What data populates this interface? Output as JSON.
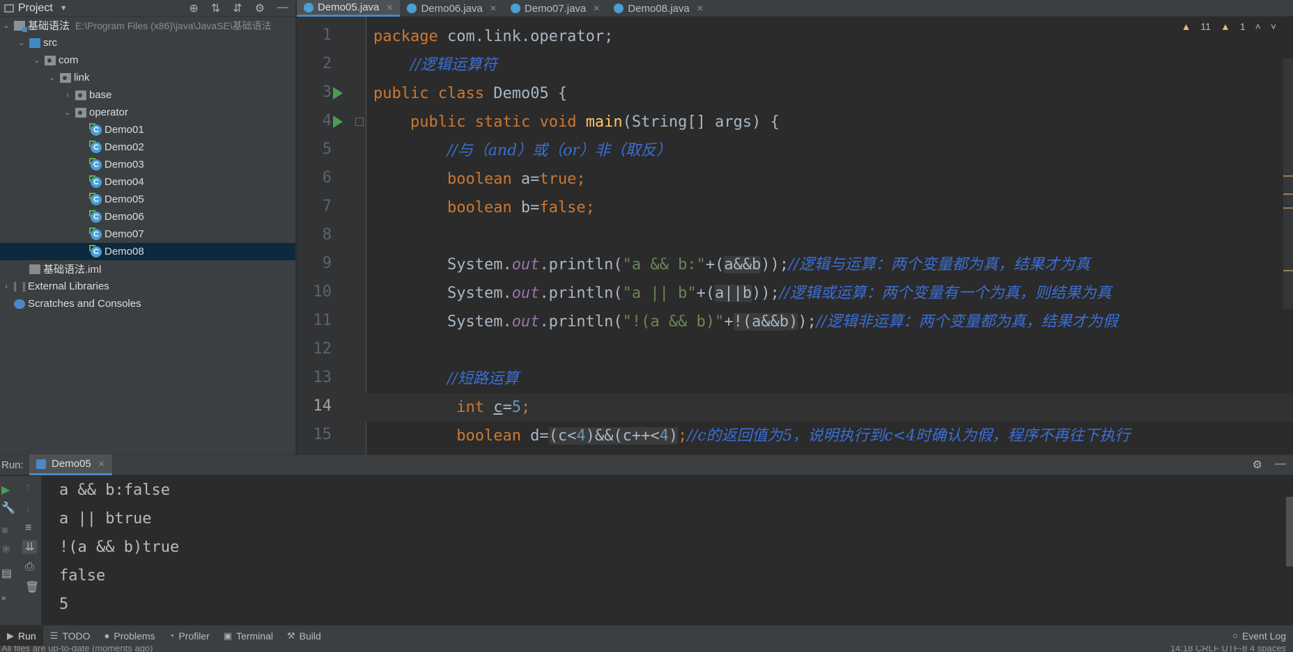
{
  "project_panel": {
    "title": "Project",
    "tree": [
      {
        "label": "基础语法",
        "path": "E:\\Program Files (x86)\\java\\JavaSE\\基础语法",
        "type": "module",
        "depth": 0,
        "arrow": "v"
      },
      {
        "label": "src",
        "type": "src-folder",
        "depth": 1,
        "arrow": "v"
      },
      {
        "label": "com",
        "type": "package",
        "depth": 2,
        "arrow": "v"
      },
      {
        "label": "link",
        "type": "package",
        "depth": 3,
        "arrow": "v"
      },
      {
        "label": "base",
        "type": "package",
        "depth": 4,
        "arrow": ">"
      },
      {
        "label": "operator",
        "type": "package",
        "depth": 4,
        "arrow": "v"
      },
      {
        "label": "Demo01",
        "type": "class",
        "depth": 5
      },
      {
        "label": "Demo02",
        "type": "class",
        "depth": 5
      },
      {
        "label": "Demo03",
        "type": "class",
        "depth": 5
      },
      {
        "label": "Demo04",
        "type": "class",
        "depth": 5
      },
      {
        "label": "Demo05",
        "type": "class",
        "depth": 5
      },
      {
        "label": "Demo06",
        "type": "class",
        "depth": 5
      },
      {
        "label": "Demo07",
        "type": "class",
        "depth": 5
      },
      {
        "label": "Demo08",
        "type": "class",
        "depth": 5,
        "selected": true
      },
      {
        "label": "基础语法.iml",
        "type": "iml",
        "depth": 1
      },
      {
        "label": "External Libraries",
        "type": "libs",
        "depth": 0,
        "arrow": ">"
      },
      {
        "label": "Scratches and Consoles",
        "type": "scratches",
        "depth": 0
      }
    ]
  },
  "editor": {
    "tabs": [
      {
        "label": "Demo05.java",
        "active": true
      },
      {
        "label": "Demo06.java"
      },
      {
        "label": "Demo07.java"
      },
      {
        "label": "Demo08.java"
      }
    ],
    "inspections": {
      "warnings": "11",
      "weak_warnings": "1"
    },
    "line_numbers": [
      "1",
      "2",
      "3",
      "4",
      "5",
      "6",
      "7",
      "8",
      "9",
      "10",
      "11",
      "12",
      "13",
      "14",
      "15"
    ],
    "code": {
      "l1_kw": "package",
      "l1_rest": " com.link.operator;",
      "l2_cmt": "//逻辑运算符",
      "l3_kw1": "public",
      "l3_kw2": "class",
      "l3_rest": " Demo05 {",
      "l4_kw1": "public",
      "l4_kw2": "static",
      "l4_kw3": "void",
      "l4_fn": "main",
      "l4_rest": "(String[] args) {",
      "l5_cmt": "//与（and）或（or）非（取反）",
      "l6_kw": "boolean",
      "l6_mid": " a=",
      "l6_val": "true",
      "l6_end": ";",
      "l7_kw": "boolean",
      "l7_mid": " b=",
      "l7_val": "false",
      "l7_end": ";",
      "l9_a": "System.",
      "l9_field": "out",
      "l9_b": ".println(",
      "l9_str": "\"a && b:\"",
      "l9_c": "+(",
      "l9_hl": "a&&b",
      "l9_d": "));",
      "l9_cmt": "//逻辑与运算：两个变量都为真，结果才为真",
      "l10_a": "System.",
      "l10_field": "out",
      "l10_b": ".println(",
      "l10_str": "\"a || b\"",
      "l10_c": "+(",
      "l10_hl": "a||b",
      "l10_d": "));",
      "l10_cmt": "//逻辑或运算：两个变量有一个为真，则结果为真",
      "l11_a": "System.",
      "l11_field": "out",
      "l11_b": ".println(",
      "l11_str": "\"!(a && b)\"",
      "l11_c": "+",
      "l11_hl": "!(a&&b)",
      "l11_d": ");",
      "l11_cmt": "//逻辑非运算：两个变量都为真，结果才为假",
      "l13_cmt": "//短路运算",
      "l14_kw": "int",
      "l14_var": "c",
      "l14_mid": "=",
      "l14_num": "5",
      "l14_end": ";",
      "l15_kw": "boolean",
      "l15_a": " d=",
      "l15_hl1": "(c<",
      "l15_n1": "4",
      "l15_hl2": ")&&(c++<",
      "l15_n2": "4",
      "l15_hl3": ")",
      "l15_end": ";",
      "l15_cmt": "//c的返回值为5，说明执行到c<4时确认为假，程序不再往下执行"
    }
  },
  "run_panel": {
    "label": "Run:",
    "tab": "Demo05",
    "output": [
      "a && b:false",
      "a || btrue",
      "!(a && b)true",
      "false",
      "5"
    ]
  },
  "bottom_bar": {
    "items": [
      {
        "label": "Run",
        "icon": "play-icon",
        "active": true
      },
      {
        "label": "TODO",
        "icon": "list-icon"
      },
      {
        "label": "Problems",
        "icon": "info-icon"
      },
      {
        "label": "Profiler",
        "icon": "profiler-icon"
      },
      {
        "label": "Terminal",
        "icon": "terminal-icon"
      },
      {
        "label": "Build",
        "icon": "hammer-icon"
      }
    ],
    "event_log": "Event Log"
  },
  "status_bar": {
    "message": "All files are up-to-date (moments ago)",
    "right": "14:18   CRLF   UTF-8   4 spaces"
  },
  "colors": {
    "keyword": "#cc7832",
    "string": "#6a8759",
    "number": "#6897bb",
    "comment": "#3a6fd6",
    "accent": "#4a88c7"
  }
}
